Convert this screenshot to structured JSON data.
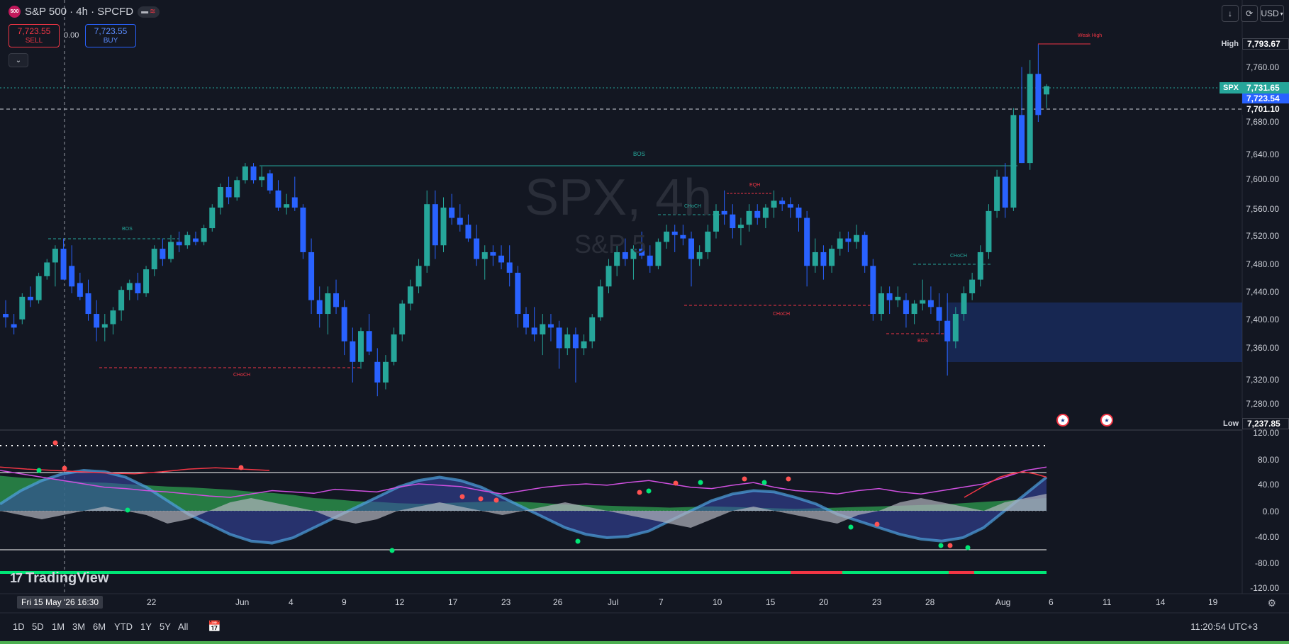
{
  "header": {
    "symbol_title": "S&P 500 · 4h · SPCFD",
    "logo_text": "500",
    "sell_price": "7,723.55",
    "sell_label": "SELL",
    "buy_price": "7,723.55",
    "buy_label": "BUY",
    "spread": "0.00",
    "collapse_icon": "chevron-down-icon",
    "currency": "USD"
  },
  "watermark": {
    "main": "SPX, 4h",
    "sub": "S&P 5"
  },
  "price_axis": {
    "ticks": [
      "7,760.00",
      "7,680.00",
      "7,640.00",
      "7,600.00",
      "7,560.00",
      "7,520.00",
      "7,480.00",
      "7,440.00",
      "7,400.00",
      "7,360.00",
      "7,320.00",
      "7,280.00"
    ],
    "high_label": "High",
    "high_value": "7,793.67",
    "low_label": "Low",
    "low_value": "7,237.85",
    "spx_label": "SPX",
    "spx_value": "7,731.65",
    "bid_value": "7,723.54",
    "dash_value": "7,701.10"
  },
  "osc_axis": {
    "ticks": [
      "120.00",
      "80.00",
      "40.00",
      "0.00",
      "-40.00",
      "-80.00",
      "-120.00"
    ]
  },
  "annotations": {
    "weak_high": "Weak High",
    "bos_main": "BOS",
    "bos_left": "BOS",
    "bos_low": "BOS",
    "choch_left": "CHoCH",
    "choch_mid": "CHoCH",
    "choch_red": "CHoCH",
    "choch_right": "CHoCH",
    "eqh": "EQH"
  },
  "time_axis": {
    "crosshair": "Fri 15 May '26   16:30",
    "labels": [
      "22",
      "Jun",
      "4",
      "9",
      "12",
      "17",
      "23",
      "26",
      "Jul",
      "7",
      "10",
      "15",
      "20",
      "23",
      "28",
      "Aug",
      "6",
      "11",
      "14",
      "19"
    ]
  },
  "toolbar": {
    "ranges": [
      "1D",
      "5D",
      "1M",
      "3M",
      "6M",
      "YTD",
      "1Y",
      "5Y",
      "All"
    ],
    "clock": "11:20:54 UTC+3"
  },
  "branding": {
    "name": "TradingView"
  },
  "colors": {
    "up": "#26a69a",
    "down": "#2962ff",
    "bg": "#131722",
    "red": "#f23645"
  },
  "chart_data": {
    "type": "candlestick",
    "ylim": [
      7237.85,
      7800
    ],
    "candles": [
      [
        7400,
        7420,
        7380,
        7395
      ],
      [
        7385,
        7400,
        7370,
        7380
      ],
      [
        7392,
        7430,
        7385,
        7425
      ],
      [
        7425,
        7440,
        7410,
        7420
      ],
      [
        7420,
        7460,
        7415,
        7455
      ],
      [
        7455,
        7480,
        7450,
        7475
      ],
      [
        7475,
        7500,
        7440,
        7495
      ],
      [
        7495,
        7510,
        7460,
        7450
      ],
      [
        7470,
        7500,
        7430,
        7440
      ],
      [
        7445,
        7460,
        7420,
        7425
      ],
      [
        7430,
        7450,
        7390,
        7400
      ],
      [
        7400,
        7420,
        7360,
        7380
      ],
      [
        7380,
        7400,
        7360,
        7385
      ],
      [
        7385,
        7410,
        7370,
        7405
      ],
      [
        7405,
        7440,
        7390,
        7435
      ],
      [
        7435,
        7450,
        7420,
        7445
      ],
      [
        7445,
        7460,
        7420,
        7430
      ],
      [
        7430,
        7470,
        7425,
        7465
      ],
      [
        7465,
        7500,
        7455,
        7495
      ],
      [
        7495,
        7510,
        7470,
        7480
      ],
      [
        7480,
        7515,
        7475,
        7505
      ],
      [
        7505,
        7520,
        7490,
        7500
      ],
      [
        7500,
        7520,
        7495,
        7515
      ],
      [
        7510,
        7520,
        7500,
        7505
      ],
      [
        7505,
        7530,
        7500,
        7525
      ],
      [
        7525,
        7560,
        7520,
        7555
      ],
      [
        7555,
        7590,
        7545,
        7585
      ],
      [
        7585,
        7600,
        7560,
        7570
      ],
      [
        7570,
        7600,
        7565,
        7595
      ],
      [
        7595,
        7620,
        7590,
        7615
      ],
      [
        7615,
        7620,
        7590,
        7595
      ],
      [
        7595,
        7615,
        7585,
        7600
      ],
      [
        7605,
        7610,
        7575,
        7580
      ],
      [
        7580,
        7595,
        7550,
        7555
      ],
      [
        7555,
        7575,
        7545,
        7560
      ],
      [
        7570,
        7600,
        7550,
        7555
      ],
      [
        7555,
        7560,
        7480,
        7490
      ],
      [
        7490,
        7510,
        7400,
        7420
      ],
      [
        7420,
        7440,
        7380,
        7400
      ],
      [
        7400,
        7440,
        7370,
        7430
      ],
      [
        7430,
        7450,
        7400,
        7410
      ],
      [
        7410,
        7420,
        7340,
        7360
      ],
      [
        7360,
        7380,
        7300,
        7330
      ],
      [
        7330,
        7380,
        7320,
        7375
      ],
      [
        7375,
        7400,
        7340,
        7345
      ],
      [
        7330,
        7350,
        7280,
        7300
      ],
      [
        7300,
        7340,
        7290,
        7330
      ],
      [
        7330,
        7380,
        7325,
        7370
      ],
      [
        7370,
        7420,
        7360,
        7415
      ],
      [
        7415,
        7450,
        7405,
        7440
      ],
      [
        7440,
        7480,
        7430,
        7470
      ],
      [
        7470,
        7580,
        7460,
        7560
      ],
      [
        7560,
        7580,
        7480,
        7500
      ],
      [
        7500,
        7570,
        7490,
        7555
      ],
      [
        7555,
        7575,
        7530,
        7540
      ],
      [
        7540,
        7560,
        7520,
        7530
      ],
      [
        7530,
        7545,
        7505,
        7510
      ],
      [
        7510,
        7530,
        7470,
        7480
      ],
      [
        7480,
        7500,
        7450,
        7490
      ],
      [
        7490,
        7500,
        7470,
        7485
      ],
      [
        7485,
        7500,
        7465,
        7475
      ],
      [
        7475,
        7500,
        7440,
        7460
      ],
      [
        7460,
        7470,
        7380,
        7400
      ],
      [
        7400,
        7410,
        7370,
        7380
      ],
      [
        7380,
        7410,
        7360,
        7370
      ],
      [
        7370,
        7400,
        7340,
        7385
      ],
      [
        7385,
        7400,
        7360,
        7380
      ],
      [
        7380,
        7390,
        7320,
        7350
      ],
      [
        7350,
        7380,
        7340,
        7370
      ],
      [
        7370,
        7380,
        7300,
        7350
      ],
      [
        7350,
        7370,
        7340,
        7360
      ],
      [
        7360,
        7400,
        7350,
        7395
      ],
      [
        7395,
        7450,
        7390,
        7440
      ],
      [
        7440,
        7480,
        7430,
        7470
      ],
      [
        7470,
        7500,
        7455,
        7490
      ],
      [
        7490,
        7510,
        7470,
        7480
      ],
      [
        7480,
        7500,
        7450,
        7495
      ],
      [
        7495,
        7520,
        7480,
        7485
      ],
      [
        7485,
        7500,
        7460,
        7470
      ],
      [
        7470,
        7510,
        7465,
        7505
      ],
      [
        7505,
        7530,
        7495,
        7520
      ],
      [
        7520,
        7530,
        7490,
        7515
      ],
      [
        7515,
        7530,
        7500,
        7510
      ],
      [
        7510,
        7520,
        7440,
        7480
      ],
      [
        7480,
        7500,
        7470,
        7490
      ],
      [
        7490,
        7530,
        7480,
        7520
      ],
      [
        7520,
        7560,
        7510,
        7550
      ],
      [
        7550,
        7580,
        7530,
        7545
      ],
      [
        7545,
        7560,
        7510,
        7525
      ],
      [
        7525,
        7540,
        7500,
        7530
      ],
      [
        7530,
        7560,
        7520,
        7550
      ],
      [
        7550,
        7560,
        7530,
        7540
      ],
      [
        7540,
        7560,
        7525,
        7555
      ],
      [
        7555,
        7580,
        7540,
        7565
      ],
      [
        7565,
        7570,
        7550,
        7560
      ],
      [
        7560,
        7570,
        7540,
        7555
      ],
      [
        7555,
        7560,
        7520,
        7540
      ],
      [
        7540,
        7550,
        7440,
        7470
      ],
      [
        7470,
        7510,
        7460,
        7490
      ],
      [
        7490,
        7500,
        7450,
        7470
      ],
      [
        7470,
        7500,
        7460,
        7495
      ],
      [
        7495,
        7520,
        7485,
        7510
      ],
      [
        7510,
        7520,
        7490,
        7505
      ],
      [
        7505,
        7530,
        7495,
        7515
      ],
      [
        7515,
        7520,
        7460,
        7470
      ],
      [
        7470,
        7480,
        7390,
        7400
      ],
      [
        7400,
        7440,
        7390,
        7430
      ],
      [
        7430,
        7440,
        7400,
        7420
      ],
      [
        7420,
        7440,
        7410,
        7425
      ],
      [
        7420,
        7430,
        7380,
        7400
      ],
      [
        7400,
        7420,
        7385,
        7415
      ],
      [
        7415,
        7450,
        7405,
        7420
      ],
      [
        7420,
        7440,
        7400,
        7410
      ],
      [
        7410,
        7430,
        7370,
        7390
      ],
      [
        7390,
        7430,
        7310,
        7360
      ],
      [
        7360,
        7410,
        7350,
        7400
      ],
      [
        7400,
        7440,
        7390,
        7430
      ],
      [
        7430,
        7460,
        7420,
        7450
      ],
      [
        7450,
        7500,
        7440,
        7490
      ],
      [
        7490,
        7560,
        7480,
        7550
      ],
      [
        7550,
        7610,
        7540,
        7600
      ],
      [
        7600,
        7620,
        7540,
        7555
      ],
      [
        7555,
        7700,
        7550,
        7690
      ],
      [
        7690,
        7760,
        7620,
        7620
      ],
      [
        7620,
        7770,
        7610,
        7750
      ],
      [
        7750,
        7793,
        7680,
        7690
      ],
      [
        7720,
        7735,
        7700,
        7732
      ]
    ]
  }
}
